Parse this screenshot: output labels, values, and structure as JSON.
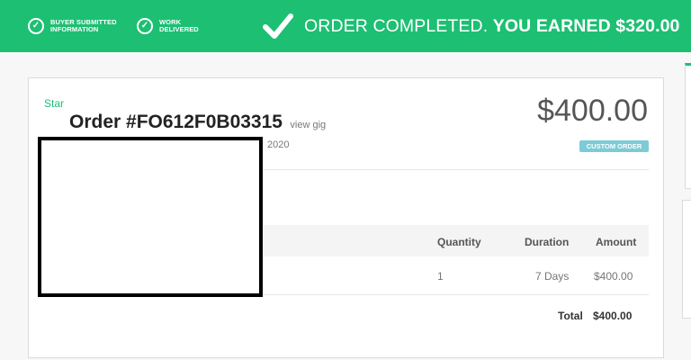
{
  "banner": {
    "steps": [
      {
        "line1": "BUYER SUBMITTED",
        "line2": "INFORMATION"
      },
      {
        "line1": "WORK",
        "line2": "DELIVERED"
      }
    ],
    "status_text": "ORDER COMPLETED.",
    "earned_text": "YOU EARNED $320.00",
    "color": "#1dbf73"
  },
  "order": {
    "star_label": "Star",
    "number": "Order #FO612F0B03315",
    "view_link": "view gig",
    "date_fragment": "2020",
    "price": "$400.00",
    "badge": "CUSTOM ORDER",
    "badge_color": "#7dcbd7"
  },
  "table": {
    "headers": {
      "quantity": "Quantity",
      "duration": "Duration",
      "amount": "Amount"
    },
    "rows": [
      {
        "quantity": "1",
        "duration": "7 Days",
        "amount": "$400.00"
      }
    ],
    "total_label": "Total",
    "total_value": "$400.00"
  }
}
